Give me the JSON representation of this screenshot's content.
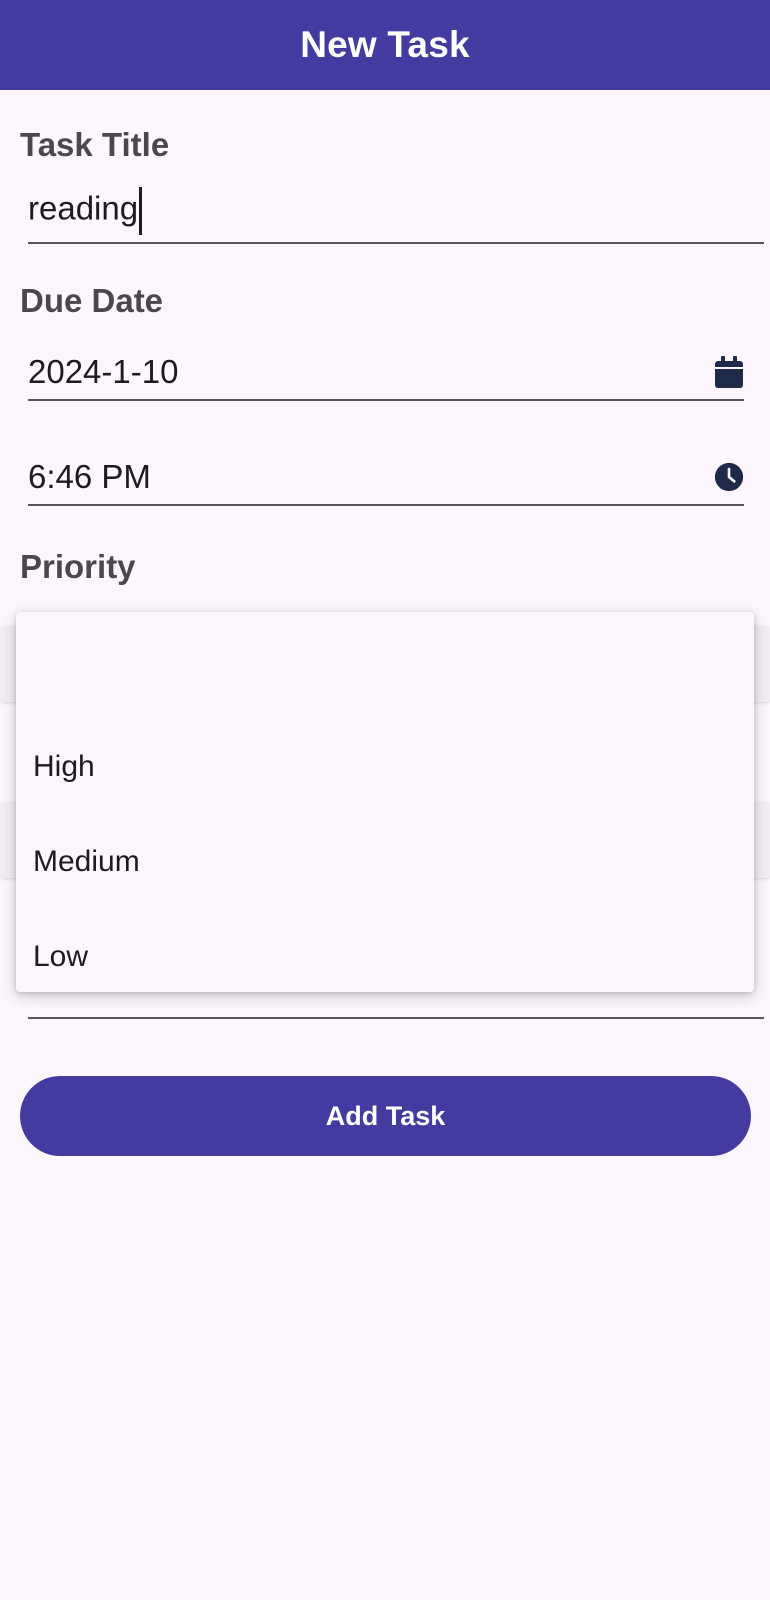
{
  "app_bar": {
    "title": "New Task"
  },
  "task_title": {
    "label": "Task Title",
    "value": "reading"
  },
  "due_date": {
    "label": "Due Date",
    "date_value": "2024-1-10",
    "date_icon": "calendar-icon",
    "time_value": "6:46 PM",
    "time_icon": "clock-icon"
  },
  "priority": {
    "label": "Priority",
    "options": [
      "High",
      "Medium",
      "Low"
    ]
  },
  "actions": {
    "add_task_label": "Add Task"
  },
  "colors": {
    "primary": "#433b9f",
    "background": "#fdf7fd",
    "label_text": "#4a484c",
    "icon": "#1f2a4a"
  }
}
